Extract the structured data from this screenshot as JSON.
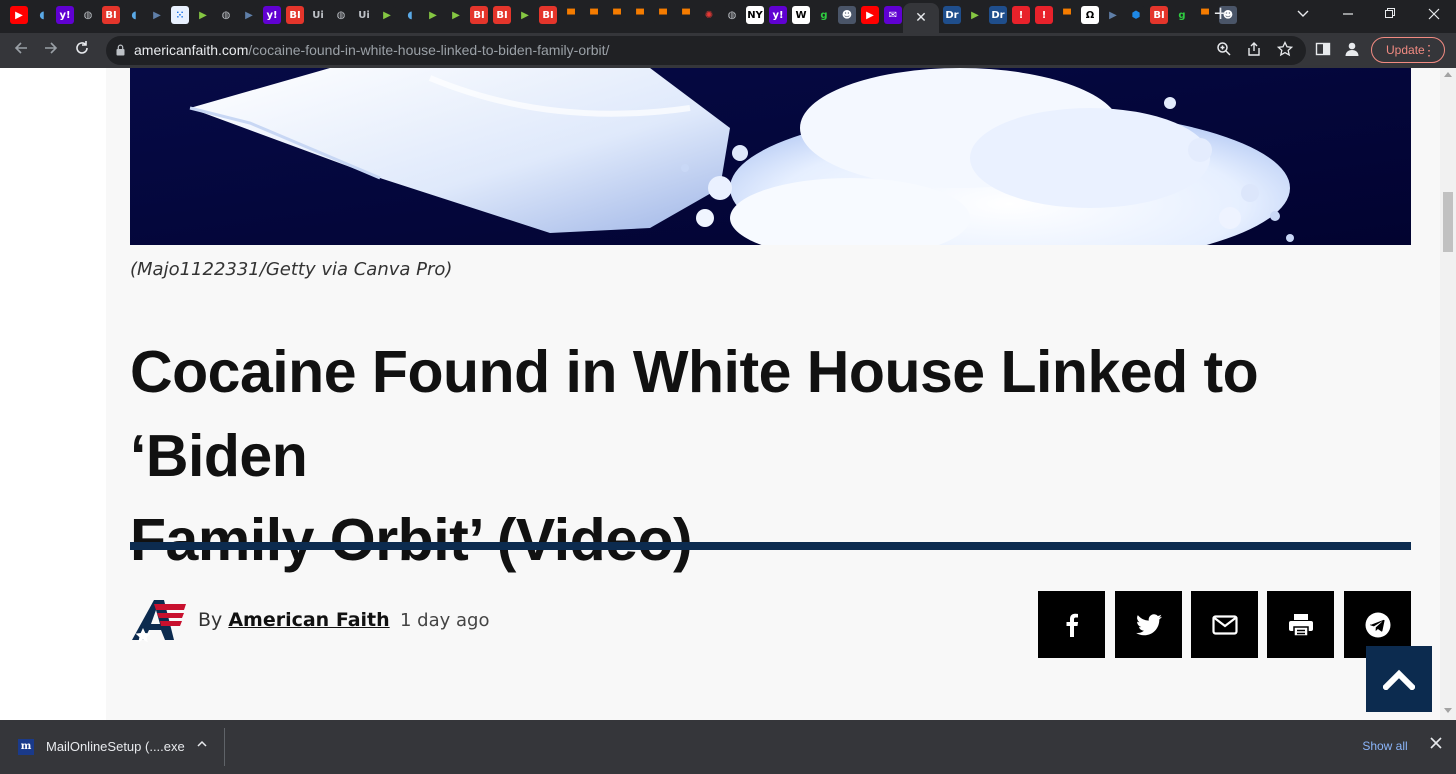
{
  "browser": {
    "tabs": [
      {
        "icon": "youtube-icon",
        "glyph": "▶",
        "bg": "#ff0000",
        "fg": "#ffffff"
      },
      {
        "icon": "shield-icon",
        "glyph": "◖",
        "bg": "#202124",
        "fg": "#5aa9e6"
      },
      {
        "icon": "yahoo-icon",
        "glyph": "y!",
        "bg": "#6001d2",
        "fg": "#ffffff"
      },
      {
        "icon": "globe-icon",
        "glyph": "◍",
        "bg": "#202124",
        "fg": "#bdc1c6"
      },
      {
        "icon": "business-insider-icon",
        "glyph": "BI",
        "bg": "#e4352b",
        "fg": "#ffffff"
      },
      {
        "icon": "shield-icon",
        "glyph": "◖",
        "bg": "#202124",
        "fg": "#5aa9e6"
      },
      {
        "icon": "arrow-tag-icon",
        "glyph": "▶",
        "bg": "#202124",
        "fg": "#5f7fa8"
      },
      {
        "icon": "grid-icon",
        "glyph": "⁙",
        "bg": "#e8f0fe",
        "fg": "#1a73e8"
      },
      {
        "icon": "rumble-icon",
        "glyph": "▶",
        "bg": "#202124",
        "fg": "#85c742"
      },
      {
        "icon": "globe-icon",
        "glyph": "◍",
        "bg": "#202124",
        "fg": "#bdc1c6"
      },
      {
        "icon": "arrow-tag-icon",
        "glyph": "▶",
        "bg": "#202124",
        "fg": "#5f7fa8"
      },
      {
        "icon": "yahoo-icon",
        "glyph": "y!",
        "bg": "#6001d2",
        "fg": "#ffffff"
      },
      {
        "icon": "business-insider-icon",
        "glyph": "BI",
        "bg": "#e4352b",
        "fg": "#ffffff"
      },
      {
        "icon": "ui-icon",
        "glyph": "Ui",
        "bg": "#202124",
        "fg": "#bdc1c6"
      },
      {
        "icon": "globe-icon",
        "glyph": "◍",
        "bg": "#202124",
        "fg": "#bdc1c6"
      },
      {
        "icon": "ui-icon",
        "glyph": "Ui",
        "bg": "#202124",
        "fg": "#bdc1c6"
      },
      {
        "icon": "rumble-icon",
        "glyph": "▶",
        "bg": "#202124",
        "fg": "#85c742"
      },
      {
        "icon": "shield-icon",
        "glyph": "◖",
        "bg": "#202124",
        "fg": "#5aa9e6"
      },
      {
        "icon": "rumble-icon",
        "glyph": "▶",
        "bg": "#202124",
        "fg": "#85c742"
      },
      {
        "icon": "rumble-icon",
        "glyph": "▶",
        "bg": "#202124",
        "fg": "#85c742"
      },
      {
        "icon": "business-insider-icon",
        "glyph": "BI",
        "bg": "#e4352b",
        "fg": "#ffffff"
      },
      {
        "icon": "business-insider-icon",
        "glyph": "BI",
        "bg": "#e4352b",
        "fg": "#ffffff"
      },
      {
        "icon": "rumble-icon",
        "glyph": "▶",
        "bg": "#202124",
        "fg": "#85c742"
      },
      {
        "icon": "business-insider-icon",
        "glyph": "BI",
        "bg": "#e4352b",
        "fg": "#ffffff"
      },
      {
        "icon": "bookmark-banner-icon",
        "glyph": "▀",
        "bg": "#202124",
        "fg": "#f57c00"
      },
      {
        "icon": "bookmark-banner-icon",
        "glyph": "▀",
        "bg": "#202124",
        "fg": "#f57c00"
      },
      {
        "icon": "bookmark-banner-icon",
        "glyph": "▀",
        "bg": "#202124",
        "fg": "#f57c00"
      },
      {
        "icon": "bookmark-banner-icon",
        "glyph": "▀",
        "bg": "#202124",
        "fg": "#f57c00"
      },
      {
        "icon": "bookmark-banner-icon",
        "glyph": "▀",
        "bg": "#202124",
        "fg": "#f57c00"
      },
      {
        "icon": "bookmark-banner-icon",
        "glyph": "▀",
        "bg": "#202124",
        "fg": "#f57c00"
      },
      {
        "icon": "starburst-icon",
        "glyph": "✺",
        "bg": "#202124",
        "fg": "#e53935"
      },
      {
        "icon": "globe-icon",
        "glyph": "◍",
        "bg": "#202124",
        "fg": "#bdc1c6"
      },
      {
        "icon": "news-icon",
        "glyph": "NY",
        "bg": "#ffffff",
        "fg": "#000000"
      },
      {
        "icon": "yahoo-icon",
        "glyph": "y!",
        "bg": "#6001d2",
        "fg": "#ffffff"
      },
      {
        "icon": "wikipedia-icon",
        "glyph": "W",
        "bg": "#ffffff",
        "fg": "#000000"
      },
      {
        "icon": "g-icon",
        "glyph": "g",
        "bg": "#202124",
        "fg": "#2ecc40"
      },
      {
        "icon": "avatar-icon",
        "glyph": "☻",
        "bg": "#4a5568",
        "fg": "#ffffff"
      },
      {
        "icon": "youtube-icon",
        "glyph": "▶",
        "bg": "#ff0000",
        "fg": "#ffffff"
      },
      {
        "icon": "mail-icon",
        "glyph": "✉",
        "bg": "#6001d2",
        "fg": "#ffffff"
      },
      {
        "icon": "close-icon",
        "glyph": "✕",
        "bg": "#35363a",
        "fg": "#e8eaed",
        "active": true
      },
      {
        "icon": "dr-icon",
        "glyph": "Dr",
        "bg": "#1f4e8c",
        "fg": "#ffffff"
      },
      {
        "icon": "rumble-icon",
        "glyph": "▶",
        "bg": "#202124",
        "fg": "#85c742"
      },
      {
        "icon": "dr-icon",
        "glyph": "Dr",
        "bg": "#1f4e8c",
        "fg": "#ffffff"
      },
      {
        "icon": "podcast-icon",
        "glyph": "!",
        "bg": "#e8222b",
        "fg": "#ffffff"
      },
      {
        "icon": "podcast-icon",
        "glyph": "!",
        "bg": "#e8222b",
        "fg": "#ffffff"
      },
      {
        "icon": "bookmark-banner-icon",
        "glyph": "▀",
        "bg": "#202124",
        "fg": "#f57c00"
      },
      {
        "icon": "omega-icon",
        "glyph": "Ω",
        "bg": "#ffffff",
        "fg": "#000000"
      },
      {
        "icon": "arrow-tag-icon",
        "glyph": "▶",
        "bg": "#202124",
        "fg": "#5f7fa8"
      },
      {
        "icon": "hexagon-icon",
        "glyph": "⬢",
        "bg": "#202124",
        "fg": "#1e88e5"
      },
      {
        "icon": "business-insider-icon",
        "glyph": "BI",
        "bg": "#e4352b",
        "fg": "#ffffff"
      },
      {
        "icon": "g-icon",
        "glyph": "g",
        "bg": "#202124",
        "fg": "#2ecc40"
      },
      {
        "icon": "bookmark-banner-icon",
        "glyph": "▀",
        "bg": "#202124",
        "fg": "#f57c00"
      },
      {
        "icon": "avatar-icon",
        "glyph": "☻",
        "bg": "#4a5568",
        "fg": "#ffffff"
      }
    ],
    "new_tab_label": "+",
    "url_host": "americanfaith.com",
    "url_path": "/cocaine-found-in-white-house-linked-to-biden-family-orbit/",
    "update_label": "Update"
  },
  "article": {
    "image_caption": "(Majo1122331/Getty via Canva Pro)",
    "headline_line1": "Cocaine Found in White House Linked to ‘Biden",
    "headline_line2": "Family Orbit’ (Video)",
    "byline_prefix": "By",
    "author": "American Faith",
    "date": "1 day ago"
  },
  "share_buttons": [
    {
      "name": "facebook-share-button",
      "icon": "facebook-icon"
    },
    {
      "name": "twitter-share-button",
      "icon": "twitter-icon"
    },
    {
      "name": "email-share-button",
      "icon": "email-icon"
    },
    {
      "name": "print-button",
      "icon": "printer-icon"
    },
    {
      "name": "telegram-share-button",
      "icon": "telegram-icon"
    }
  ],
  "download_bar": {
    "file_name": "MailOnlineSetup (....exe",
    "show_all_label": "Show all"
  },
  "colors": {
    "navy": "#0c2b4f",
    "chrome_dark": "#202124",
    "chrome_toolbar": "#35363a",
    "update_accent": "#f28b82",
    "link_blue": "#8ab4f8"
  }
}
